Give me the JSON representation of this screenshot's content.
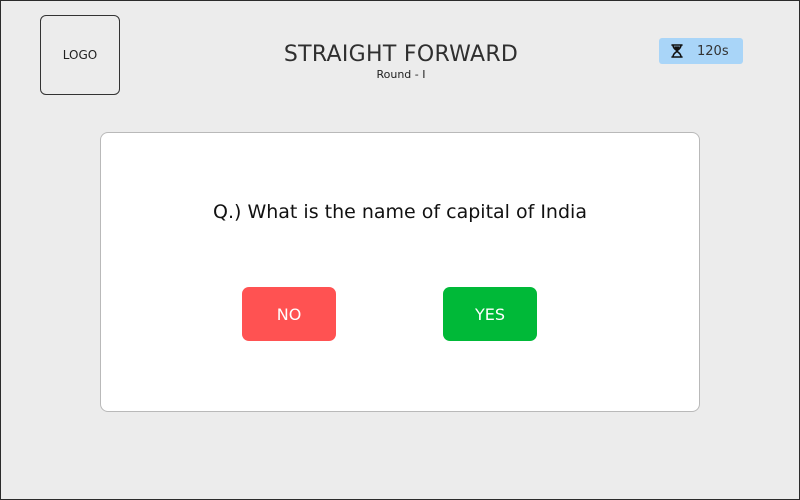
{
  "header": {
    "logo_text": "LOGO",
    "title": "STRAIGHT FORWARD",
    "subtitle": "Round - I",
    "timer": {
      "value": "120s",
      "icon": "hourglass-icon",
      "background_color": "#a9d5f8"
    }
  },
  "quiz": {
    "question": "Q.) What is the name of capital of India",
    "buttons": {
      "no_label": "NO",
      "yes_label": "YES"
    },
    "colors": {
      "no": "#ff5252",
      "yes": "#00b938"
    }
  }
}
